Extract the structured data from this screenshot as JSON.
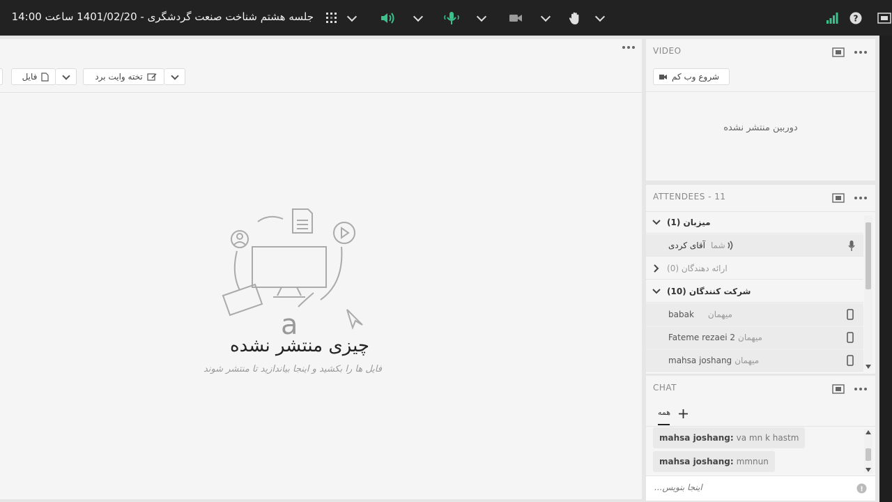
{
  "topbar": {
    "title": "جلسه هشتم شناخت صنعت گردشگری - 1401/02/20 ساعت 14:00",
    "colors": {
      "bar": "#222222",
      "active": "#3cc18c"
    },
    "icons": [
      "layout-icon",
      "speaker-icon",
      "microphone-icon",
      "camera-icon",
      "hand-icon",
      "signal-icon",
      "help-icon",
      "fullscreen-icon"
    ]
  },
  "main": {
    "toolbar": {
      "file_label": "فایل",
      "whiteboard_label": "تخته وایت برد"
    },
    "empty_title": "چیزی منتشر نشده",
    "empty_subtitle": "فایل ها را بکشید و اینجا بیاندازید تا منتشر شوند"
  },
  "video": {
    "header": "VIDEO",
    "start_webcam": "شروع وب کم",
    "no_camera": "دوربین منتشر نشده"
  },
  "attendees": {
    "header": "ATTENDEES  - 11",
    "groups": {
      "hosts": "میزبان (1)",
      "presenters": "ارائه دهندگان (0)",
      "participants": "شرکت کنندگان (10)"
    },
    "host_user": {
      "you": "شما",
      "name": "آقای کردی"
    },
    "participants": [
      {
        "name": "babak",
        "role": "میهمان"
      },
      {
        "name": "Fateme rezaei 2",
        "role": "میهمان"
      },
      {
        "name": "mahsa joshang",
        "role": "میهمان"
      }
    ]
  },
  "chat": {
    "header": "CHAT",
    "tab_label": "همه",
    "messages": [
      {
        "author": "mahsa joshang:",
        "text": "va mn k hastm"
      },
      {
        "author": "mahsa joshang:",
        "text": "mmnun"
      }
    ],
    "input_placeholder": "اینجا بنویس..."
  }
}
